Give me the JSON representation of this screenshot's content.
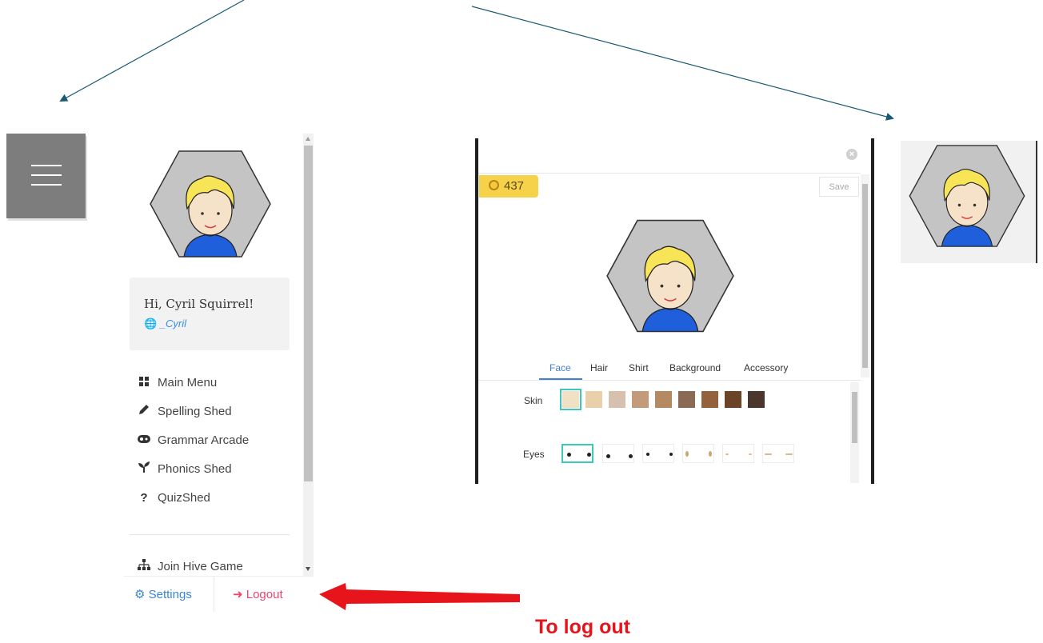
{
  "sidebar": {
    "greeting": "Hi, Cyril Squirrel!",
    "username": "_Cyril",
    "menu": [
      {
        "label": "Main Menu",
        "icon": "grid-icon"
      },
      {
        "label": "Spelling Shed",
        "icon": "pencil-icon"
      },
      {
        "label": "Grammar Arcade",
        "icon": "gamepad-icon"
      },
      {
        "label": "Phonics Shed",
        "icon": "sprout-icon"
      },
      {
        "label": "QuizShed",
        "icon": "question-icon"
      },
      {
        "label": "Join Hive Game",
        "icon": "hierarchy-icon"
      }
    ],
    "footer": {
      "settings": "Settings",
      "logout": "Logout"
    }
  },
  "editor": {
    "coins": "437",
    "save": "Save",
    "tabs": [
      "Face",
      "Hair",
      "Shirt",
      "Background",
      "Accessory"
    ],
    "active_tab": "Face",
    "rows": {
      "skin": "Skin",
      "eyes": "Eyes"
    },
    "skin_colors": [
      "#f0e0c4",
      "#e9cfaa",
      "#d7c0ae",
      "#c49b7a",
      "#b58a62",
      "#8b6a55",
      "#93613c",
      "#6b4428",
      "#4a362c"
    ]
  },
  "annotation": {
    "logout_note": "To log out"
  },
  "colors": {
    "accent": "#3f7fd6",
    "logout": "#e8476b",
    "coin_badge": "#f5d24a",
    "selected": "#3ec8b8",
    "note": "#e8141c"
  }
}
